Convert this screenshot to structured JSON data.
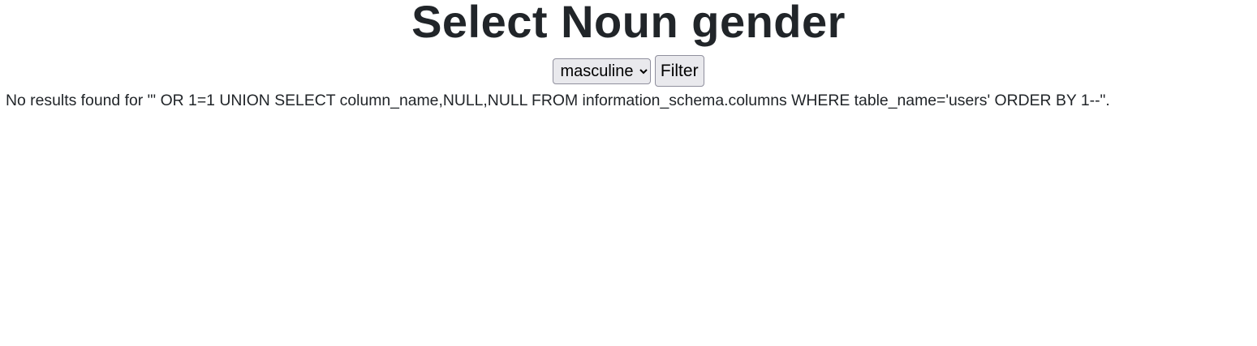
{
  "page": {
    "title": "Select Noun gender"
  },
  "filter": {
    "selected_option": "masculine",
    "button_label": "Filter"
  },
  "result": {
    "message": "No results found for \"' OR 1=1 UNION SELECT column_name,NULL,NULL FROM information_schema.columns WHERE table_name='users' ORDER BY 1--\"."
  }
}
